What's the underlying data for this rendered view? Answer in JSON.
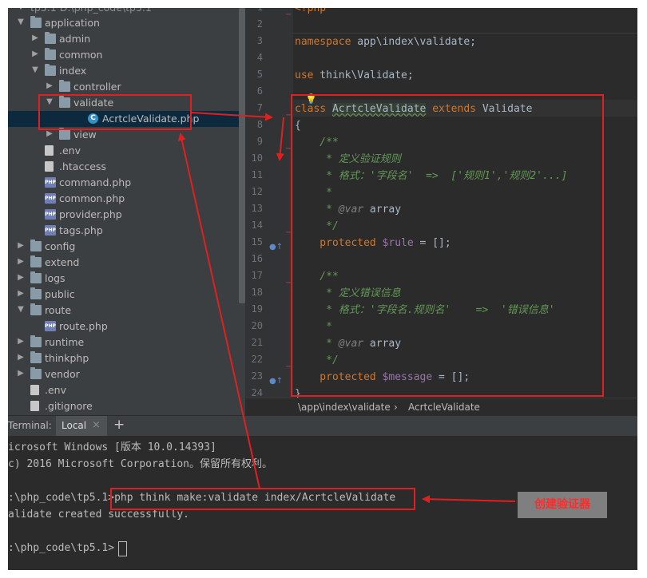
{
  "tree": {
    "top_partial": "tp5.1  D:\\php_code\\tp5.1",
    "items": [
      {
        "label": "application",
        "depth": 0,
        "arrow": "down",
        "icon": "folder"
      },
      {
        "label": "admin",
        "depth": 1,
        "arrow": "right",
        "icon": "folder"
      },
      {
        "label": "common",
        "depth": 1,
        "arrow": "right",
        "icon": "folder"
      },
      {
        "label": "index",
        "depth": 1,
        "arrow": "down",
        "icon": "folder"
      },
      {
        "label": "controller",
        "depth": 2,
        "arrow": "right",
        "icon": "folder"
      },
      {
        "label": "validate",
        "depth": 2,
        "arrow": "down",
        "icon": "folder"
      },
      {
        "label": "AcrtcleValidate.php",
        "depth": 3,
        "arrow": "",
        "icon": "class",
        "selected": true
      },
      {
        "label": "view",
        "depth": 2,
        "arrow": "right",
        "icon": "folder"
      },
      {
        "label": ".env",
        "depth": 1,
        "arrow": "",
        "icon": "file"
      },
      {
        "label": ".htaccess",
        "depth": 1,
        "arrow": "",
        "icon": "file"
      },
      {
        "label": "command.php",
        "depth": 1,
        "arrow": "",
        "icon": "php"
      },
      {
        "label": "common.php",
        "depth": 1,
        "arrow": "",
        "icon": "php"
      },
      {
        "label": "provider.php",
        "depth": 1,
        "arrow": "",
        "icon": "php"
      },
      {
        "label": "tags.php",
        "depth": 1,
        "arrow": "",
        "icon": "php"
      },
      {
        "label": "config",
        "depth": 0,
        "arrow": "right",
        "icon": "folder"
      },
      {
        "label": "extend",
        "depth": 0,
        "arrow": "right",
        "icon": "folder"
      },
      {
        "label": "logs",
        "depth": 0,
        "arrow": "right",
        "icon": "folder"
      },
      {
        "label": "public",
        "depth": 0,
        "arrow": "right",
        "icon": "folder"
      },
      {
        "label": "route",
        "depth": 0,
        "arrow": "down",
        "icon": "folder"
      },
      {
        "label": "route.php",
        "depth": 1,
        "arrow": "",
        "icon": "php"
      },
      {
        "label": "runtime",
        "depth": 0,
        "arrow": "right",
        "icon": "folder"
      },
      {
        "label": "thinkphp",
        "depth": 0,
        "arrow": "right",
        "icon": "folder"
      },
      {
        "label": "vendor",
        "depth": 0,
        "arrow": "right",
        "icon": "folder"
      },
      {
        "label": ".env",
        "depth": 0,
        "arrow": "",
        "icon": "file"
      },
      {
        "label": ".gitignore",
        "depth": 0,
        "arrow": "",
        "icon": "file"
      }
    ]
  },
  "editor": {
    "line_numbers": [
      "1",
      "2",
      "3",
      "4",
      "5",
      "6",
      "7",
      "8",
      "9",
      "10",
      "11",
      "12",
      "13",
      "14",
      "15",
      "16",
      "17",
      "18",
      "19",
      "20",
      "21",
      "22",
      "23",
      "24"
    ],
    "code": {
      "l1": "<?php",
      "l3_kw": "namespace",
      "l3_rest": " app\\index\\validate;",
      "l5_kw": "use",
      "l5_rest": " think\\Validate;",
      "l7_kw1": "class",
      "l7_name": "AcrtcleValidate",
      "l7_kw2": "extends",
      "l7_parent": "Validate",
      "l8": "{",
      "l9": "    /**",
      "l10": "     * 定义验证规则",
      "l11": "     * 格式：'字段名'  =>  ['规则1','规则2'...]",
      "l12": "     *",
      "l13_a": "     * ",
      "l13_tag": "@var",
      "l13_b": " array",
      "l14": "     */",
      "l15_kw": "    protected",
      "l15_var": " $rule",
      "l15_rest": " = [];",
      "l17": "    /**",
      "l18": "     * 定义错误信息",
      "l19": "     * 格式：'字段名.规则名'    =>  '错误信息'",
      "l20": "     *",
      "l21_a": "     * ",
      "l21_tag": "@var",
      "l21_b": " array",
      "l22": "     */",
      "l23_kw": "    protected",
      "l23_var": " $message",
      "l23_rest": " = [];",
      "l24": "}"
    },
    "breadcrumb_path": "\\app\\index\\validate",
    "breadcrumb_sep": "›",
    "breadcrumb_class": "AcrtcleValidate"
  },
  "terminal": {
    "title": "Terminal:",
    "tab": "Local",
    "close": "×",
    "add": "+",
    "lines": {
      "l1": "icrosoft Windows [版本 10.0.14393]",
      "l2": "c) 2016 Microsoft Corporation。保留所有权利。",
      "l3_prompt": ":\\php_code\\tp5.1>",
      "l3_cmd": "php think make:validate index/AcrtcleValidate",
      "l4": "alidate created successfully.",
      "l5_prompt": ":\\php_code\\tp5.1>"
    }
  },
  "annotation": {
    "label": "创建验证器"
  },
  "colors": {
    "annotation": "#e02020",
    "keyword": "#cc7832",
    "comment": "#629755",
    "variable": "#9876aa"
  }
}
